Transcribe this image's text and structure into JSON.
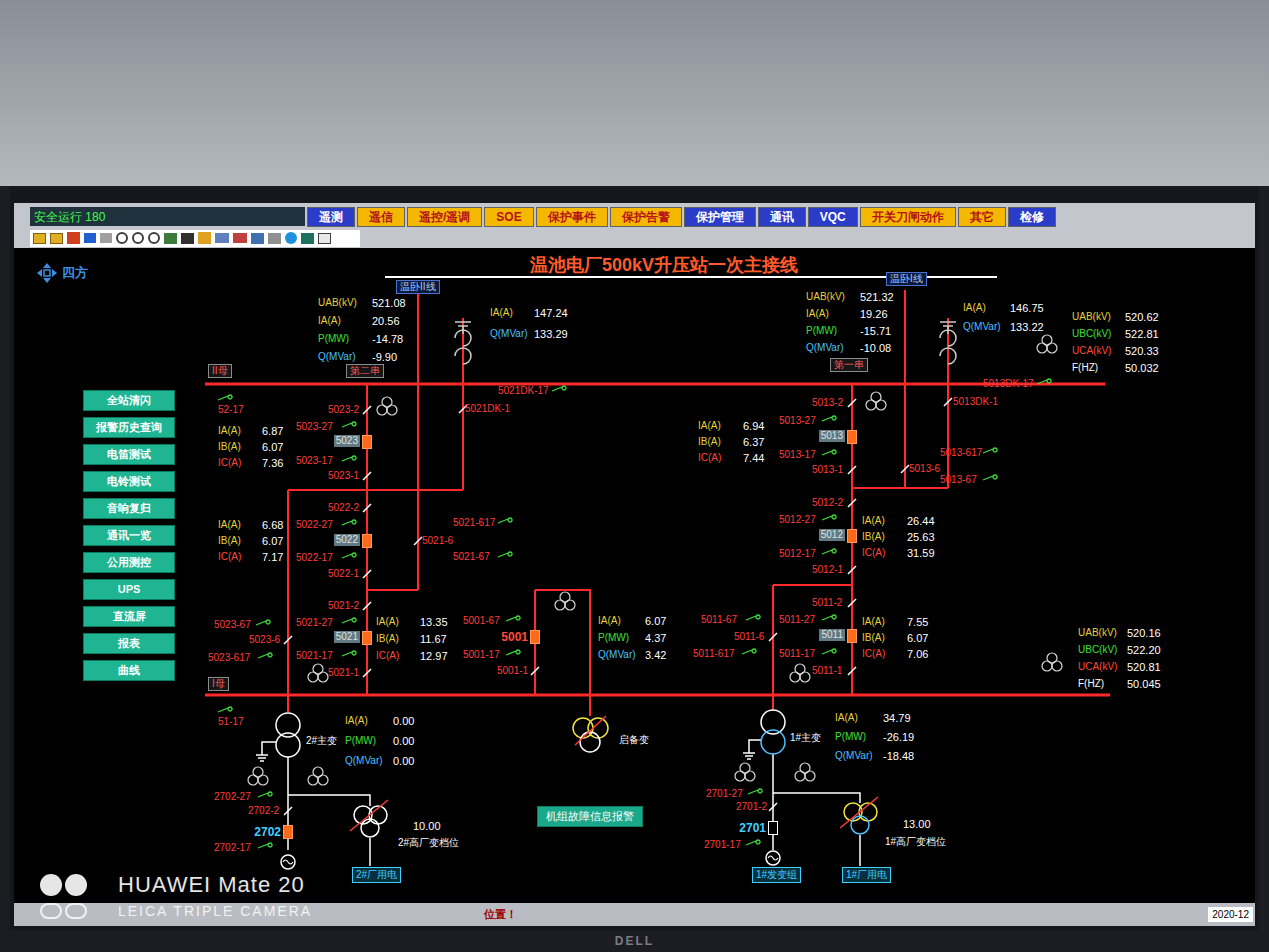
{
  "status": {
    "label": "安全运行 180"
  },
  "tabs": [
    {
      "label": "遥测",
      "color": "#2a3cc8"
    },
    {
      "label": "遥信",
      "color": "#f5b800"
    },
    {
      "label": "遥控/遥调",
      "color": "#f5b800"
    },
    {
      "label": "SOE",
      "color": "#f5b800"
    },
    {
      "label": "保护事件",
      "color": "#f5b800"
    },
    {
      "label": "保护告警",
      "color": "#f5b800"
    },
    {
      "label": "保护管理",
      "color": "#2a3cc8"
    },
    {
      "label": "通讯",
      "color": "#2a3cc8"
    },
    {
      "label": "VQC",
      "color": "#2a3cc8"
    },
    {
      "label": "开关刀闸动作",
      "color": "#f5b800"
    },
    {
      "label": "其它",
      "color": "#f5b800"
    },
    {
      "label": "检修",
      "color": "#2a3cc8"
    }
  ],
  "brand": "四方",
  "title": "温池电厂500kV升压站一次主接线",
  "side_buttons": [
    "全站清闪",
    "报警历史查询",
    "电笛测试",
    "电铃测试",
    "音响复归",
    "通讯一览",
    "公用测控",
    "UPS",
    "直流屏",
    "报表",
    "曲线"
  ],
  "labels": [
    {
      "text": "52-17",
      "kind": "switch"
    },
    {
      "text": "5023-2",
      "kind": "switch"
    },
    {
      "text": "5023-27",
      "kind": "switch"
    },
    {
      "text": "5023-17",
      "kind": "switch"
    },
    {
      "text": "5023-1",
      "kind": "switch"
    },
    {
      "text": "5022-2",
      "kind": "switch"
    },
    {
      "text": "5022-27",
      "kind": "switch"
    },
    {
      "text": "5022-17",
      "kind": "switch"
    },
    {
      "text": "5022-1",
      "kind": "switch"
    },
    {
      "text": "5021-2",
      "kind": "switch"
    },
    {
      "text": "5021-27",
      "kind": "switch"
    },
    {
      "text": "5021-17",
      "kind": "switch"
    },
    {
      "text": "5021-1",
      "kind": "switch"
    },
    {
      "text": "5023-67",
      "kind": "switch"
    },
    {
      "text": "5023-6",
      "kind": "switch"
    },
    {
      "text": "5023-617",
      "kind": "switch"
    },
    {
      "text": "5021DK-17",
      "kind": "switch"
    },
    {
      "text": "5021DK-1",
      "kind": "switch"
    },
    {
      "text": "5021-617",
      "kind": "switch"
    },
    {
      "text": "5021-6",
      "kind": "switch"
    },
    {
      "text": "5021-67",
      "kind": "switch"
    },
    {
      "text": "5001-67",
      "kind": "switch"
    },
    {
      "text": "5001-17",
      "kind": "switch"
    },
    {
      "text": "5001-1",
      "kind": "switch"
    },
    {
      "text": "51-17",
      "kind": "switch"
    },
    {
      "text": "5013-2",
      "kind": "switch"
    },
    {
      "text": "5013-27",
      "kind": "switch"
    },
    {
      "text": "5013-17",
      "kind": "switch"
    },
    {
      "text": "5013-1",
      "kind": "switch"
    },
    {
      "text": "5013DK-17",
      "kind": "switch"
    },
    {
      "text": "5013DK-1",
      "kind": "switch"
    },
    {
      "text": "5013-6",
      "kind": "switch"
    },
    {
      "text": "5013-617",
      "kind": "switch"
    },
    {
      "text": "5013-67",
      "kind": "switch"
    },
    {
      "text": "5012-2",
      "kind": "switch"
    },
    {
      "text": "5012-27",
      "kind": "switch"
    },
    {
      "text": "5012-17",
      "kind": "switch"
    },
    {
      "text": "5012-1",
      "kind": "switch"
    },
    {
      "text": "5011-2",
      "kind": "switch"
    },
    {
      "text": "5011-27",
      "kind": "switch"
    },
    {
      "text": "5011-17",
      "kind": "switch"
    },
    {
      "text": "5011-1",
      "kind": "switch"
    },
    {
      "text": "5011-67",
      "kind": "switch"
    },
    {
      "text": "5011-6",
      "kind": "switch"
    },
    {
      "text": "5011-617",
      "kind": "switch"
    },
    {
      "text": "2702-27",
      "kind": "switch"
    },
    {
      "text": "2702-2",
      "kind": "switch"
    },
    {
      "text": "2702-17",
      "kind": "switch"
    },
    {
      "text": "2701-27",
      "kind": "switch"
    },
    {
      "text": "2701-2",
      "kind": "switch"
    },
    {
      "text": "2701-17",
      "kind": "switch"
    },
    {
      "text": "2#主变",
      "kind": "equipment"
    },
    {
      "text": "1#主变",
      "kind": "equipment"
    },
    {
      "text": "启备变",
      "kind": "equipment"
    },
    {
      "text": "2#高厂变档位",
      "kind": "equipment"
    },
    {
      "text": "1#高厂变档位",
      "kind": "equipment"
    },
    {
      "text": "10.00",
      "kind": "value"
    },
    {
      "text": "13.00",
      "kind": "value"
    },
    {
      "text": "1#发变组",
      "kind": "box"
    },
    {
      "text": "2#厂用电",
      "kind": "box"
    },
    {
      "text": "1#厂用电",
      "kind": "box"
    },
    {
      "text": "II母",
      "kind": "tag"
    },
    {
      "text": "I母",
      "kind": "tag"
    },
    {
      "text": "第二串",
      "kind": "tag"
    },
    {
      "text": "第一串",
      "kind": "tag"
    },
    {
      "text": "温卧II线",
      "kind": "line"
    },
    {
      "text": "温卧I线",
      "kind": "line"
    },
    {
      "text": "机组故障信息报警",
      "kind": "button"
    }
  ],
  "breakers": [
    {
      "label": "5023",
      "kind": "string",
      "closed": true
    },
    {
      "label": "5022",
      "kind": "string",
      "closed": true
    },
    {
      "label": "5021",
      "kind": "string",
      "closed": true
    },
    {
      "label": "5013",
      "kind": "string",
      "closed": true
    },
    {
      "label": "5012",
      "kind": "string",
      "closed": true
    },
    {
      "label": "5011",
      "kind": "string",
      "closed": true
    },
    {
      "label": "5001",
      "kind": "tie",
      "closed": true
    },
    {
      "label": "2702",
      "kind": "unit",
      "closed": true
    },
    {
      "label": "2701",
      "kind": "unit",
      "closed": false
    }
  ],
  "measurements": [
    {
      "rows": [
        {
          "name": "UAB(kV)",
          "value": "521.08",
          "color": "#e6d23c"
        },
        {
          "name": "IA(A)",
          "value": "20.56",
          "color": "#e6d23c"
        },
        {
          "name": "P(MW)",
          "value": "-14.78",
          "color": "#3be03b"
        },
        {
          "name": "Q(MVar)",
          "value": "-9.90",
          "color": "#4cc0ff"
        }
      ]
    },
    {
      "rows": [
        {
          "name": "IA(A)",
          "value": "147.24",
          "color": "#e6d23c"
        },
        {
          "name": "Q(MVar)",
          "value": "133.29",
          "color": "#4cc0ff"
        }
      ]
    },
    {
      "rows": [
        {
          "name": "UAB(kV)",
          "value": "521.32",
          "color": "#e6d23c"
        },
        {
          "name": "IA(A)",
          "value": "19.26",
          "color": "#e6d23c"
        },
        {
          "name": "P(MW)",
          "value": "-15.71",
          "color": "#3be03b"
        },
        {
          "name": "Q(MVar)",
          "value": "-10.08",
          "color": "#4cc0ff"
        }
      ]
    },
    {
      "rows": [
        {
          "name": "IA(A)",
          "value": "146.75",
          "color": "#e6d23c"
        },
        {
          "name": "Q(MVar)",
          "value": "133.22",
          "color": "#4cc0ff"
        }
      ]
    },
    {
      "rows": [
        {
          "name": "UAB(kV)",
          "value": "520.62",
          "color": "#e6d23c"
        },
        {
          "name": "UBC(kV)",
          "value": "522.81",
          "color": "#3be03b"
        },
        {
          "name": "UCA(kV)",
          "value": "520.33",
          "color": "#ff4a3a"
        },
        {
          "name": "F(HZ)",
          "value": "50.032",
          "color": "#ffffff"
        }
      ]
    },
    {
      "rows": [
        {
          "name": "IA(A)",
          "value": "6.87",
          "color": "#e6d23c"
        },
        {
          "name": "IB(A)",
          "value": "6.07",
          "color": "#e6d23c"
        },
        {
          "name": "IC(A)",
          "value": "7.36",
          "color": "#ff4a3a"
        }
      ]
    },
    {
      "rows": [
        {
          "name": "IA(A)",
          "value": "6.68",
          "color": "#e6d23c"
        },
        {
          "name": "IB(A)",
          "value": "6.07",
          "color": "#e6d23c"
        },
        {
          "name": "IC(A)",
          "value": "7.17",
          "color": "#ff4a3a"
        }
      ]
    },
    {
      "rows": [
        {
          "name": "IA(A)",
          "value": "13.35",
          "color": "#e6d23c"
        },
        {
          "name": "IB(A)",
          "value": "11.67",
          "color": "#e6d23c"
        },
        {
          "name": "IC(A)",
          "value": "12.97",
          "color": "#ff4a3a"
        }
      ]
    },
    {
      "rows": [
        {
          "name": "IA(A)",
          "value": "6.07",
          "color": "#e6d23c"
        },
        {
          "name": "P(MW)",
          "value": "4.37",
          "color": "#3be03b"
        },
        {
          "name": "Q(MVar)",
          "value": "3.42",
          "color": "#4cc0ff"
        }
      ]
    },
    {
      "rows": [
        {
          "name": "IA(A)",
          "value": "6.94",
          "color": "#e6d23c"
        },
        {
          "name": "IB(A)",
          "value": "6.37",
          "color": "#e6d23c"
        },
        {
          "name": "IC(A)",
          "value": "7.44",
          "color": "#ff4a3a"
        }
      ]
    },
    {
      "rows": [
        {
          "name": "IA(A)",
          "value": "26.44",
          "color": "#e6d23c"
        },
        {
          "name": "IB(A)",
          "value": "25.63",
          "color": "#e6d23c"
        },
        {
          "name": "IC(A)",
          "value": "31.59",
          "color": "#ff4a3a"
        }
      ]
    },
    {
      "rows": [
        {
          "name": "IA(A)",
          "value": "7.55",
          "color": "#e6d23c"
        },
        {
          "name": "IB(A)",
          "value": "6.07",
          "color": "#e6d23c"
        },
        {
          "name": "IC(A)",
          "value": "7.06",
          "color": "#ff4a3a"
        }
      ]
    },
    {
      "rows": [
        {
          "name": "UAB(kV)",
          "value": "520.16",
          "color": "#e6d23c"
        },
        {
          "name": "UBC(kV)",
          "value": "522.20",
          "color": "#3be03b"
        },
        {
          "name": "UCA(kV)",
          "value": "520.81",
          "color": "#ff4a3a"
        },
        {
          "name": "F(HZ)",
          "value": "50.045",
          "color": "#ffffff"
        }
      ]
    },
    {
      "rows": [
        {
          "name": "IA(A)",
          "value": "0.00",
          "color": "#e6d23c"
        },
        {
          "name": "P(MW)",
          "value": "0.00",
          "color": "#3be03b"
        },
        {
          "name": "Q(MVar)",
          "value": "0.00",
          "color": "#4cc0ff"
        }
      ]
    },
    {
      "rows": [
        {
          "name": "IA(A)",
          "value": "34.79",
          "color": "#e6d23c"
        },
        {
          "name": "P(MW)",
          "value": "-26.19",
          "color": "#3be03b"
        },
        {
          "name": "Q(MVar)",
          "value": "-18.48",
          "color": "#4cc0ff"
        }
      ]
    }
  ],
  "status_bar": {
    "text": "位置！",
    "date": "2020-12"
  },
  "watermark": {
    "line1": "HUAWEI Mate 20",
    "line2": "LEICA TRIPLE CAMERA"
  },
  "monitor_brand": "DELL"
}
